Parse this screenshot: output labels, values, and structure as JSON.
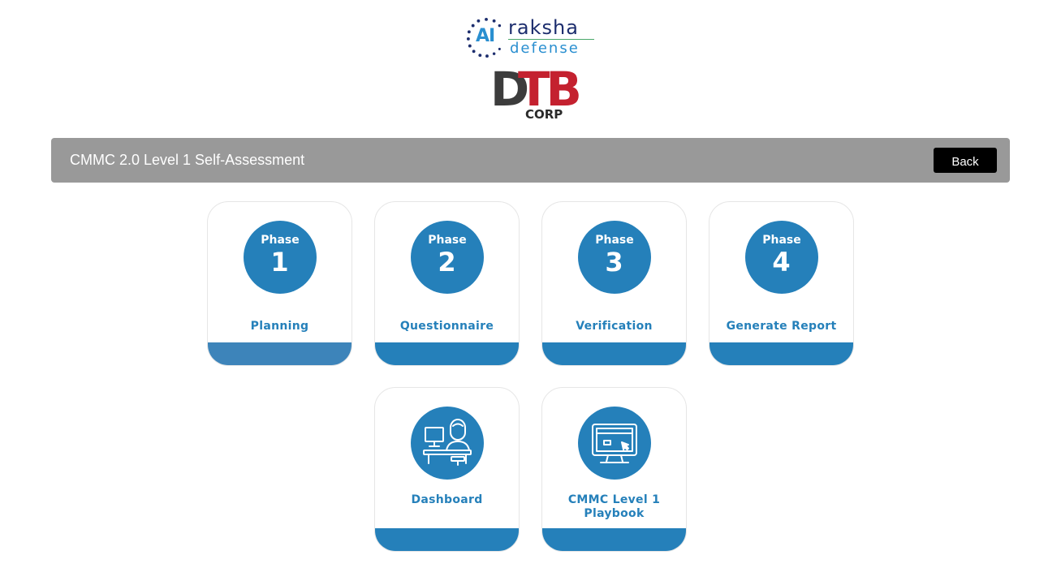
{
  "logos": {
    "ai_mark": "AI",
    "brand_top": "raksha",
    "brand_bottom": "defense",
    "dtb_d": "D",
    "dtb_tb": "TB",
    "dtb_corp": "CORP"
  },
  "header": {
    "title": "CMMC 2.0 Level 1 Self-Assessment",
    "back_label": "Back"
  },
  "phases": [
    {
      "word": "Phase",
      "number": "1",
      "label": "Planning"
    },
    {
      "word": "Phase",
      "number": "2",
      "label": "Questionnaire"
    },
    {
      "word": "Phase",
      "number": "3",
      "label": "Verification"
    },
    {
      "word": "Phase",
      "number": "4",
      "label": "Generate Report"
    }
  ],
  "tools": [
    {
      "label": "Dashboard",
      "icon": "person-at-desk-icon"
    },
    {
      "label_line1": "CMMC Level 1",
      "label_line2": "Playbook",
      "icon": "monitor-cursor-icon"
    }
  ],
  "colors": {
    "accent": "#2580ba",
    "header_bg": "#999999",
    "back_button_bg": "#000000",
    "brand_red": "#c4212f"
  }
}
